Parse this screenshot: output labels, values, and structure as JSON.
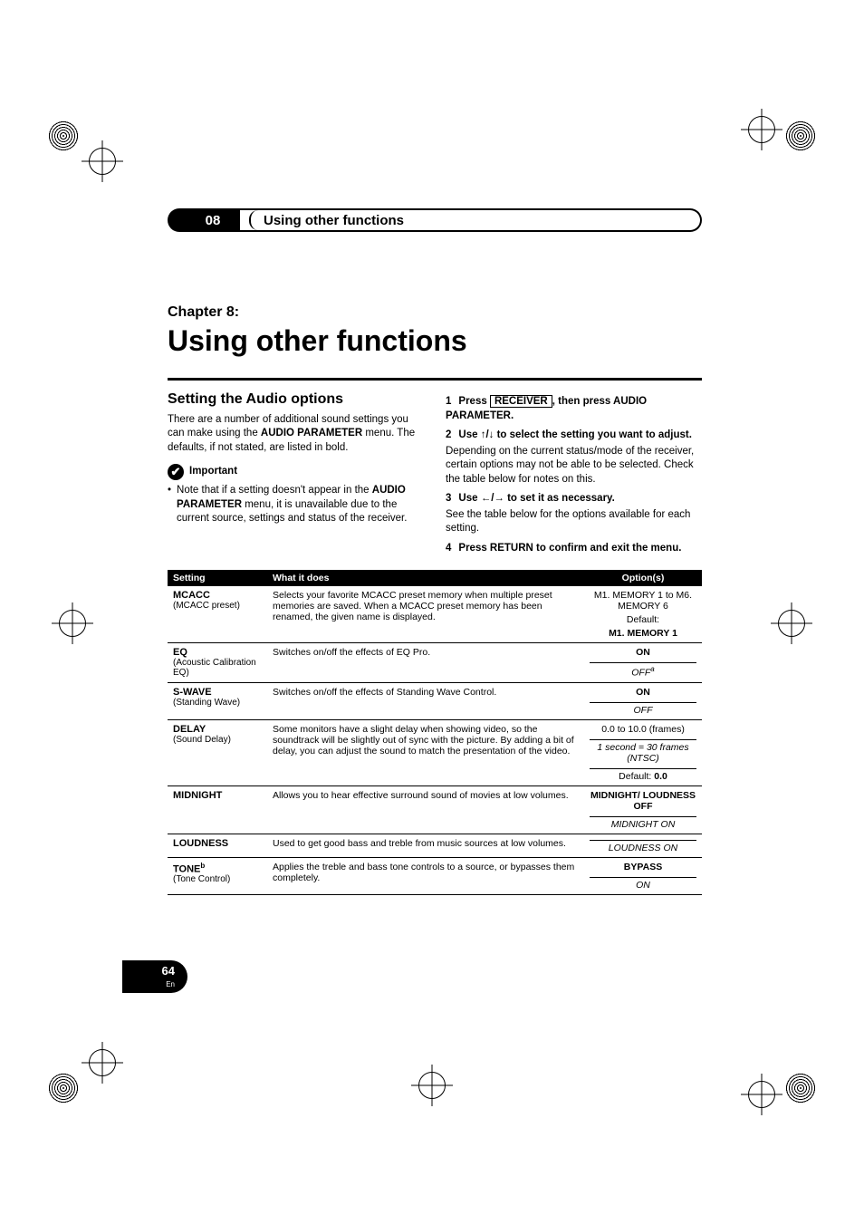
{
  "header": {
    "chapter_num": "08",
    "strip_title": "Using other functions"
  },
  "chapter": {
    "label": "Chapter 8:",
    "title": "Using other functions"
  },
  "left_col": {
    "section_title": "Setting the Audio options",
    "intro_a": "There are a number of additional sound settings you can make using the ",
    "intro_bold_1": "AUDIO PARAMETER",
    "intro_b": " menu. The defaults, if not stated, are listed in bold.",
    "important_label": "Important",
    "bullet_a": "Note that if a setting doesn't appear in the ",
    "bullet_bold": "AUDIO PARAMETER",
    "bullet_b": " menu, it is unavailable due to the current source, settings and status of the receiver."
  },
  "right_col": {
    "s1_num": "1",
    "s1_a": "Press ",
    "s1_framed": "RECEIVER",
    "s1_b": ", then press AUDIO PARAMETER.",
    "s2_num": "2",
    "s2_a": "Use ",
    "s2_icons": "↑/↓",
    "s2_b": " to select the setting you want to adjust.",
    "s2_body": "Depending on the current status/mode of the receiver, certain options may not be able to be selected. Check the table below for notes on this.",
    "s3_num": "3",
    "s3_a": "Use ",
    "s3_icons": "←/→",
    "s3_b": " to set it as necessary.",
    "s3_body": "See the table below for the options available for each setting.",
    "s4_num": "4",
    "s4_a": "Press RETURN to confirm and exit the menu."
  },
  "table": {
    "head": {
      "c1": "Setting",
      "c2": "What it does",
      "c3": "Option(s)"
    },
    "rows": [
      {
        "name": "MCACC",
        "sub": "(MCACC preset)",
        "desc": "Selects your favorite MCACC preset memory when multiple preset memories are saved. When a MCACC preset memory has been renamed, the given name is displayed.",
        "opts": [
          {
            "text": "M1. MEMORY 1 to M6. MEMORY 6",
            "cls": ""
          },
          {
            "text": "Default:",
            "cls": ""
          },
          {
            "text": "M1. MEMORY 1",
            "cls": "opt-bold"
          }
        ]
      },
      {
        "name": "EQ",
        "sub": "(Acoustic Calibration EQ)",
        "desc": "Switches on/off the effects of EQ Pro.",
        "opts": [
          {
            "text": "ON",
            "cls": "opt-bold"
          },
          {
            "text": "OFF",
            "cls": "opt-italic opt-divider",
            "sup": "a"
          }
        ]
      },
      {
        "name": "S-WAVE",
        "sub": "(Standing Wave)",
        "desc": "Switches on/off the effects of Standing Wave Control.",
        "opts": [
          {
            "text": "ON",
            "cls": "opt-bold"
          },
          {
            "text": "OFF",
            "cls": "opt-italic opt-divider"
          }
        ]
      },
      {
        "name": "DELAY",
        "sub": "(Sound Delay)",
        "desc": "Some monitors have a slight delay when showing video, so the soundtrack will be slightly out of sync with the picture. By adding a bit of delay, you can adjust the sound to match the presentation of the video.",
        "opts": [
          {
            "text": "0.0 to 10.0 (frames)",
            "cls": ""
          },
          {
            "text": "1 second = 30 frames (NTSC)",
            "cls": "opt-italic opt-divider"
          },
          {
            "text_a": "Default: ",
            "text_b": "0.0",
            "cls": "opt-divider",
            "compound": true
          }
        ]
      },
      {
        "name": "MIDNIGHT",
        "sub": "",
        "desc": "Allows you to hear effective surround sound of movies at low volumes.",
        "opts": [
          {
            "text": "MIDNIGHT/ LOUDNESS OFF",
            "cls": "opt-bold"
          },
          {
            "text": "MIDNIGHT ON",
            "cls": "opt-italic opt-divider"
          }
        ],
        "merge_next": true
      },
      {
        "name": "LOUDNESS",
        "sub": "",
        "desc": "Used to get good bass and treble from music sources at low volumes.",
        "opts": [
          {
            "text": "LOUDNESS ON",
            "cls": "opt-italic opt-divider"
          }
        ]
      },
      {
        "name": "TONE",
        "name_sup": "b",
        "sub": "(Tone Control)",
        "desc": "Applies the treble and bass tone controls to a source, or bypasses them completely.",
        "opts": [
          {
            "text": "BYPASS",
            "cls": "opt-bold"
          },
          {
            "text": "ON",
            "cls": "opt-italic opt-divider"
          }
        ]
      }
    ]
  },
  "footer": {
    "page": "64",
    "lang": "En"
  },
  "chart_data": {
    "type": "table",
    "note": "Settings table; data captured in table.rows above."
  }
}
